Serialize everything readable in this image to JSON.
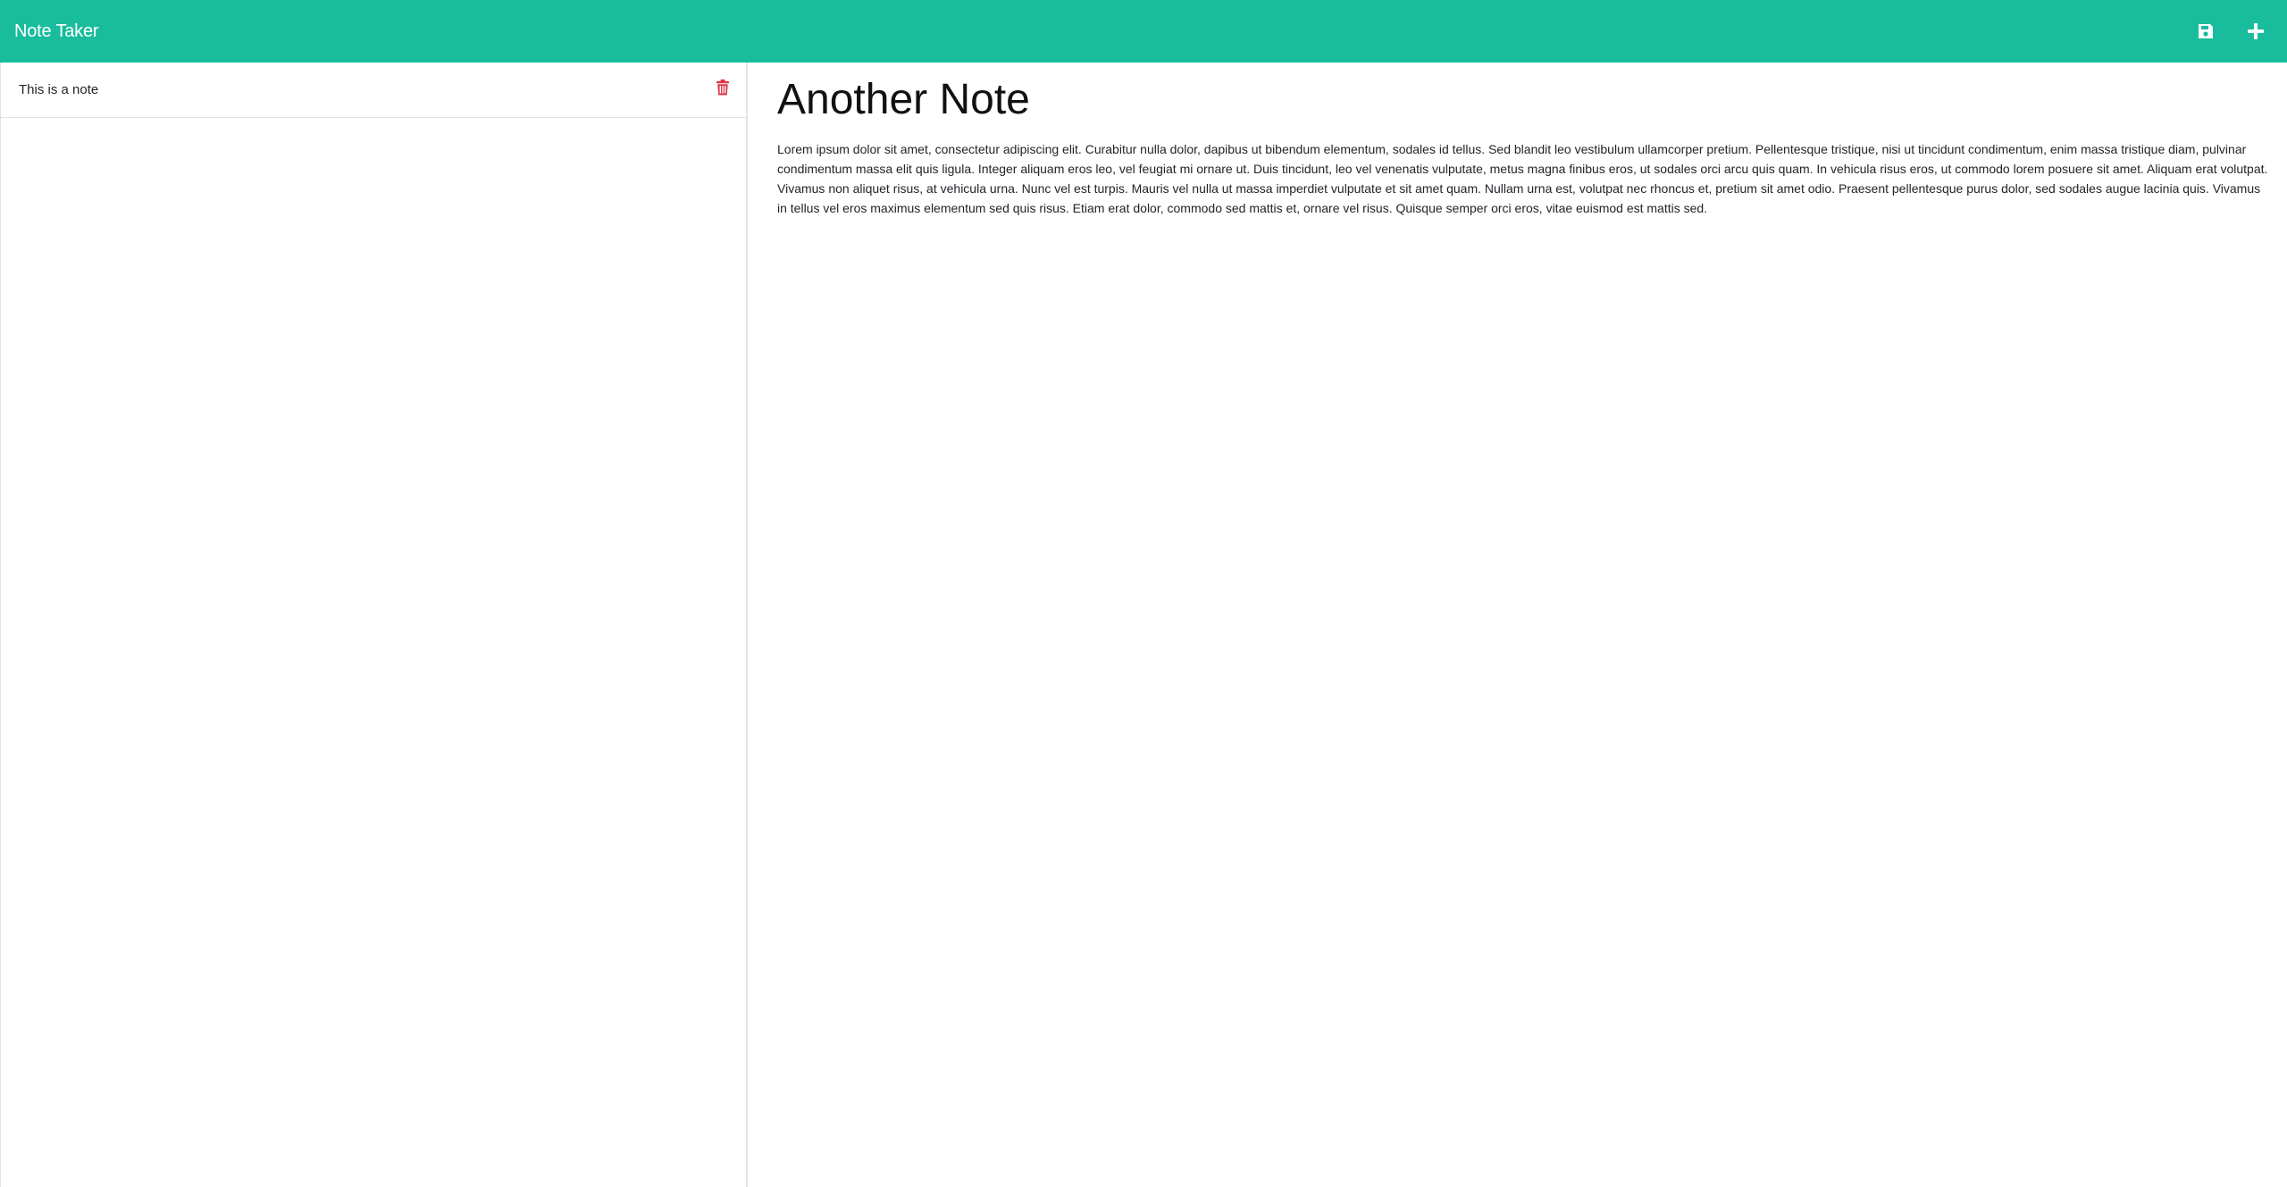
{
  "app": {
    "brand": "Note Taker",
    "accent_color": "#19bc9c"
  },
  "toolbar": {
    "save_icon": "save-icon",
    "new_icon": "plus-icon"
  },
  "sidebar": {
    "notes": [
      {
        "title": "This is a note",
        "delete_icon": "trash-icon"
      }
    ]
  },
  "editor": {
    "title": "Another Note",
    "body": "Lorem ipsum dolor sit amet, consectetur adipiscing elit. Curabitur nulla dolor, dapibus ut bibendum elementum, sodales id tellus. Sed blandit leo vestibulum ullamcorper pretium. Pellentesque tristique, nisi ut tincidunt condimentum, enim massa tristique diam, pulvinar condimentum massa elit quis ligula. Integer aliquam eros leo, vel feugiat mi ornare ut. Duis tincidunt, leo vel venenatis vulputate, metus magna finibus eros, ut sodales orci arcu quis quam. In vehicula risus eros, ut commodo lorem posuere sit amet. Aliquam erat volutpat. Vivamus non aliquet risus, at vehicula urna. Nunc vel est turpis. Mauris vel nulla ut massa imperdiet vulputate et sit amet quam. Nullam urna est, volutpat nec rhoncus et, pretium sit amet odio. Praesent pellentesque purus dolor, sed sodales augue lacinia quis. Vivamus in tellus vel eros maximus elementum sed quis risus. Etiam erat dolor, commodo sed mattis et, ornare vel risus. Quisque semper orci eros, vitae euismod est mattis sed."
  }
}
